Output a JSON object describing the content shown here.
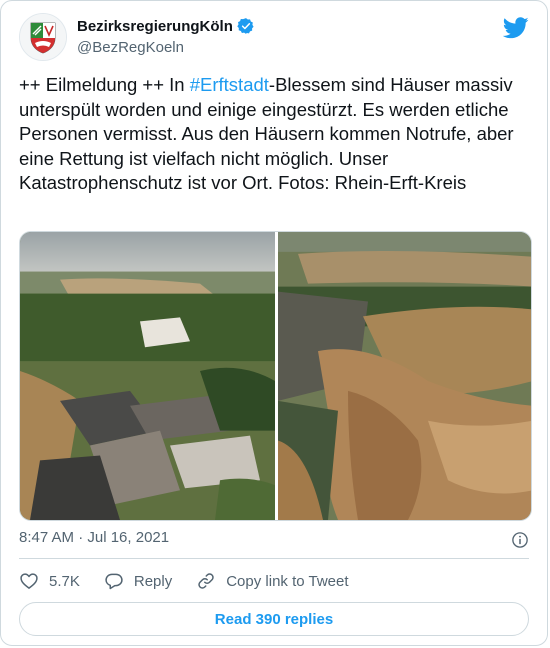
{
  "author": {
    "display_name": "BezirksregierungKöln",
    "handle": "@BezRegKoeln",
    "verified": true
  },
  "tweet": {
    "text_before": "++ Eilmeldung ++ In ",
    "hashtag": "#Erftstadt",
    "text_after": "-Blessem sind Häuser massiv unterspült worden und einige eingestürzt. Es werden etliche Personen vermisst. Aus den Häusern kommen Notrufe, aber eine Rettung ist vielfach nicht möglich. Unser Katastrophenschutz ist vor Ort. Fotos: Rhein-Erft-Kreis"
  },
  "meta": {
    "timestamp": "8:47 AM · Jul 16, 2021"
  },
  "actions": {
    "like_count": "5.7K",
    "reply_label": "Reply",
    "copy_link_label": "Copy link to Tweet"
  },
  "footer": {
    "read_replies_label": "Read 390 replies"
  },
  "colors": {
    "accent": "#1d9bf0",
    "text": "#0f1419",
    "muted": "#536471",
    "border": "#cfd9de"
  },
  "icons": [
    "twitter-bird-icon",
    "verified-badge-icon",
    "info-icon",
    "heart-icon",
    "reply-bubble-icon",
    "link-icon"
  ]
}
